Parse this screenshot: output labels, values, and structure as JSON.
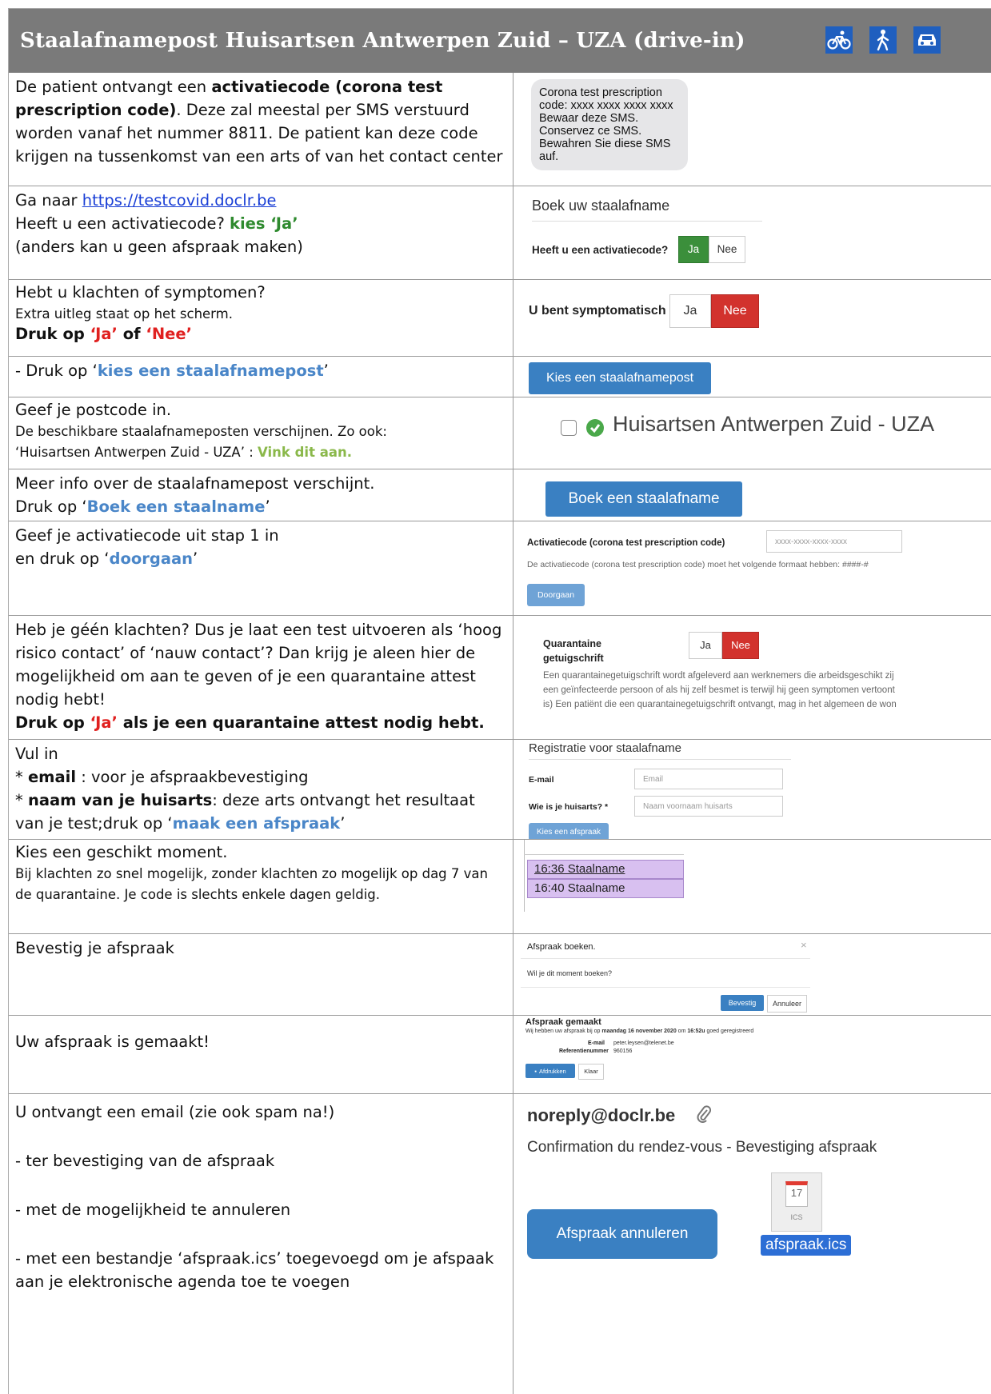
{
  "header": {
    "title": "Staalafnamepost Huisartsen Antwerpen Zuid – UZA (drive-in)",
    "icons": [
      "bicycle-icon",
      "pedestrian-icon",
      "car-icon"
    ],
    "color": "#7a7a7a"
  },
  "rows": {
    "r1": {
      "t1": "De patient ontvangt een ",
      "t2": "activatiecode (corona test prescription code)",
      "t3": ". Deze zal meestal per SMS verstuurd worden vanaf het nummer 8811. De patient kan deze code krijgen na tussenkomst van een arts of van het contact center",
      "sms": "Corona test prescription code: xxxx xxxx xxxx xxxx Bewaar deze SMS. Conservez ce SMS. Bewahren Sie diese SMS auf."
    },
    "r2": {
      "t1": "Ga naar ",
      "link": "https://testcovid.doclr.be",
      "t2": "Heeft u een activatiecode? ",
      "t3": "kies ‘Ja’",
      "t4": "(anders kan u geen afspraak maken)",
      "heading": "Boek uw staalafname",
      "question": "Heeft u een activatiecode?",
      "yes": "Ja",
      "no": "Nee"
    },
    "r3": {
      "t1": "Hebt u klachten of symptomen?",
      "t2": "Extra uitleg staat op het scherm.",
      "t3": "Druk op ",
      "t4": "‘Ja’",
      "t5": " of ",
      "t6": "‘Nee’",
      "question": "U bent symptomatisch",
      "yes": "Ja",
      "no": "Nee"
    },
    "r4": {
      "t1": "- Druk op  ‘",
      "t2": "kies een staalafnamepost",
      "t3": "’",
      "button": "Kies een staalafnamepost"
    },
    "r5": {
      "t1": "Geef je postcode in.",
      "t2": "De beschikbare staalafnameposten verschijnen. Zo ook:",
      "t3": "‘Huisartsen Antwerpen Zuid - UZA’ : ",
      "t4": "Vink dit aan.",
      "option": "Huisartsen Antwerpen Zuid - UZA"
    },
    "r6": {
      "t1": "Meer info over de staalafnamepost verschijnt.",
      "t2": "Druk op  ‘",
      "t3": "Boek een staalname",
      "t4": "’",
      "button": "Boek een staalafname"
    },
    "r7": {
      "t1": "Geef je activatiecode uit stap 1 in",
      "t2": "en druk op ‘",
      "t3": "doorgaan",
      "t4": "’",
      "label": "Activatiecode (corona test prescription code)",
      "placeholder": "xxxx-xxxx-xxxx-xxxx",
      "hint": "De activatiecode (corona test prescription code) moet het volgende formaat hebben: ####-#",
      "button": "Doorgaan"
    },
    "r8": {
      "t1": "Heb je géén klachten? Dus je laat een test uitvoeren als ‘hoog risico contact’ of ‘nauw contact’? Dan krijg je aleen hier de mogelijkheid om aan te geven of je een quarantaine attest nodig hebt!",
      "t2": "Druk op ",
      "t3": "‘Ja’",
      "t4": " als je een quarantaine attest nodig hebt.",
      "label1": "Quarantaine",
      "label2": "getuigschrift",
      "yes": "Ja",
      "no": "Nee",
      "desc1": "Een quarantainegetuigschrift wordt afgeleverd aan werknemers die arbeidsgeschikt zij",
      "desc2": "een geïnfecteerde persoon of als hij zelf besmet is terwijl hij geen symptomen vertoont",
      "desc3": "is) Een patiënt die een quarantainegetuigschrift ontvangt, mag in het algemeen de won"
    },
    "r9": {
      "t1": "Vul in",
      "t2": "* ",
      "t3": "email",
      "t4": " : voor je afspraakbevestiging",
      "t5": "* ",
      "t6": "naam van je huisarts",
      "t7": ": deze arts ontvangt het resultaat van je test;druk op ‘",
      "t8": "maak een afspraak",
      "t9": "’",
      "heading": "Registratie voor staalafname",
      "email_label": "E-mail",
      "email_placeholder": "Email",
      "doctor_label": "Wie is je huisarts? *",
      "doctor_placeholder": "Naam voornaam huisarts",
      "button": "Kies een afspraak"
    },
    "r10": {
      "t1": "Kies een geschikt moment.",
      "t2": "Bij klachten zo snel mogelijk, zonder klachten zo mogelijk op dag 7 van de quarantaine. Je code is slechts enkele dagen geldig.",
      "slot1": "16:36 Staalname",
      "slot2": "16:40 Staalname"
    },
    "r11": {
      "t1": "Bevestig je afspraak",
      "title": "Afspraak boeken.",
      "close": "×",
      "body": "Wil je dit moment boeken?",
      "confirm": "Bevestig",
      "cancel": "Annuleer"
    },
    "r12": {
      "t1": "Uw afspraak is gemaakt!",
      "title": "Afspraak gemaakt",
      "line_a": "Wij hebben uw afspraak bij op ",
      "date": "maandag 16 november 2020",
      "line_b": " om ",
      "time": "16:52u",
      "line_c": " goed geregistreerd",
      "email_label": "E-mail",
      "email_value": "peter.leysen@telenet.be",
      "ref_label": "Referentienummer",
      "ref_value": "960156",
      "print": "Afdrukken",
      "done": "Klaar"
    },
    "r13": {
      "t1": "U ontvangt een email (zie ook spam na!)",
      "t2": "- ter bevestiging van de afspraak",
      "t3": "- met de mogelijkheid te annuleren",
      "t4": "- met een bestandje ‘afspraak.ics’ toegevoegd om je afspaak aan je elektronische agenda toe te voegen",
      "sender": "noreply@doclr.be",
      "subject": "Confirmation du rendez-vous - Bevestiging afspraak",
      "cancel_button": "Afspraak annuleren",
      "cal_day": "17",
      "cal_ext": "ICS",
      "attachment": "afspraak.ics"
    }
  }
}
